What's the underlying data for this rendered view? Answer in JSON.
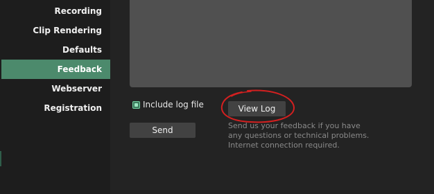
{
  "sidebar": {
    "items": [
      {
        "label": "Recording"
      },
      {
        "label": "Clip Rendering"
      },
      {
        "label": "Defaults"
      },
      {
        "label": "Feedback",
        "active": true
      },
      {
        "label": "Webserver"
      },
      {
        "label": "Registration"
      }
    ]
  },
  "feedback": {
    "message_value": "",
    "include_log_label": "Include log file",
    "include_log_checked": true,
    "view_log_label": "View Log",
    "send_label": "Send",
    "help_text": "Send us your feedback if you have any questions or technical problems. Internet connection required."
  },
  "colors": {
    "accent": "#4c8a6c",
    "annotation": "#d42020"
  }
}
